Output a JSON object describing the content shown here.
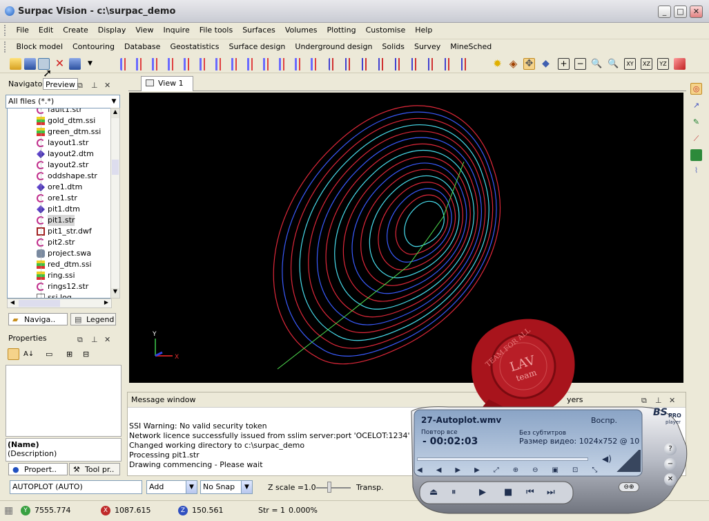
{
  "window": {
    "title": "Surpac Vision - c:\\surpac_demo",
    "minimize": "_",
    "maximize": "□",
    "close": "✕"
  },
  "menu1": [
    "File",
    "Edit",
    "Create",
    "Display",
    "View",
    "Inquire",
    "File tools",
    "Surfaces",
    "Volumes",
    "Plotting",
    "Customise",
    "Help"
  ],
  "menu2": [
    "Block model",
    "Contouring",
    "Database",
    "Geostatistics",
    "Surface design",
    "Underground design",
    "Solids",
    "Survey",
    "MineSched"
  ],
  "navigator": {
    "tab_title": "Navigator",
    "preview": "Preview",
    "filter": "All files (*.*)",
    "files": [
      {
        "name": "fault1.str",
        "icon": "string-icon"
      },
      {
        "name": "gold_dtm.ssi",
        "icon": "ssi-icon"
      },
      {
        "name": "green_dtm.ssi",
        "icon": "ssi-icon"
      },
      {
        "name": "layout1.str",
        "icon": "string-icon"
      },
      {
        "name": "layout2.dtm",
        "icon": "dtm-icon"
      },
      {
        "name": "layout2.str",
        "icon": "string-icon"
      },
      {
        "name": "oddshape.str",
        "icon": "string-icon"
      },
      {
        "name": "ore1.dtm",
        "icon": "dtm-icon"
      },
      {
        "name": "ore1.str",
        "icon": "string-icon"
      },
      {
        "name": "pit1.dtm",
        "icon": "dtm-icon"
      },
      {
        "name": "pit1.str",
        "icon": "string-icon"
      },
      {
        "name": "pit1_str.dwf",
        "icon": "dwf-icon"
      },
      {
        "name": "pit2.str",
        "icon": "string-icon"
      },
      {
        "name": "project.swa",
        "icon": "swa-icon"
      },
      {
        "name": "red_dtm.ssi",
        "icon": "ssi-icon"
      },
      {
        "name": "ring.ssi",
        "icon": "ssi-icon"
      },
      {
        "name": "rings12.str",
        "icon": "string-icon"
      },
      {
        "name": "ssi.log",
        "icon": "log-icon"
      }
    ],
    "bottom_tabs": [
      "Naviga..",
      "Legend"
    ]
  },
  "properties": {
    "title": "Properties",
    "name_label": "(Name)",
    "desc_label": "(Description)",
    "bottom_tabs": [
      "Propert..",
      "Tool pr.."
    ]
  },
  "view": {
    "tab": "View 1",
    "axis_x": "X",
    "axis_y": "Y"
  },
  "message_window": {
    "title": "Message window",
    "layers_label": "yers",
    "layer_label": "layer",
    "lines": [
      "SSI Warning: No valid security token",
      "Network licence successfully issued from sslim server:port 'OCELOT:1234'",
      "Changed working directory to c:\\surpac_demo",
      "Processing pit1.str",
      "Drawing commencing - Please wait"
    ]
  },
  "command": {
    "input": "AUTOPLOT (AUTO)",
    "mode": "Add",
    "snap": "No Snap",
    "zscale": "Z scale =1.0",
    "transp": "Transp."
  },
  "status": {
    "y": "7555.774",
    "x": "1087.615",
    "z": "150.561",
    "str": "Str = 1",
    "pct": "0.000%"
  },
  "player": {
    "file": "27-Autoplot.wmv",
    "mode": "Воспр.",
    "repeat": "Повтор все",
    "time": "- 00:02:03",
    "subs": "Без субтитров",
    "size": "Размер видео: 1024x752 @ 10",
    "brand1": "BS",
    "brand2": "PRO",
    "brand3": "player",
    "progress": 0.0
  },
  "seal": {
    "arc": "TEAM FOR ALL",
    "main": "LAV",
    "sub": "team"
  },
  "colors": {
    "canvas": "#000000",
    "contour_red": "#e0283a",
    "contour_blue": "#3a5cff",
    "contour_cyan": "#49e0f0",
    "contour_green": "#50e050"
  }
}
